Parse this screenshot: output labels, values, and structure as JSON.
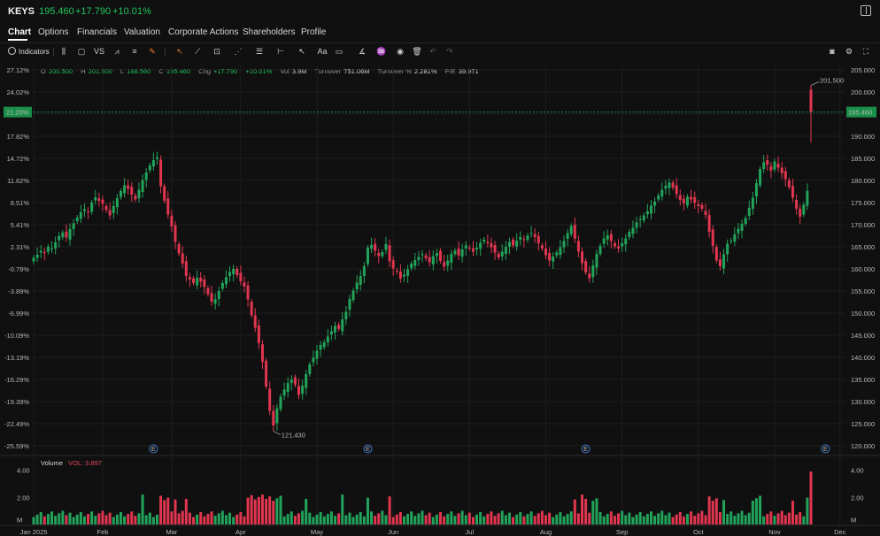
{
  "header": {
    "ticker": "KEYS",
    "price": "195.460",
    "change": "+17.790",
    "change_pct": "+10.01%"
  },
  "tabs": [
    {
      "label": "Chart",
      "active": true
    },
    {
      "label": "Options",
      "active": false
    },
    {
      "label": "Financials",
      "active": false
    },
    {
      "label": "Valuation",
      "active": false
    },
    {
      "label": "Corporate Actions",
      "active": false
    },
    {
      "label": "Shareholders",
      "active": false
    },
    {
      "label": "Profile",
      "active": false
    }
  ],
  "toolbar": {
    "indicators_label": "Indicators",
    "vs_label": "VS",
    "font_label": "Aa"
  },
  "ohlc": {
    "o_label": "O",
    "o": "200.500",
    "h_label": "H",
    "h": "201.500",
    "l_label": "L",
    "l": "188.560",
    "c_label": "C",
    "c": "195.460",
    "chg_label": "Chg",
    "chg": "+17.790",
    "chg_pct": "+10.01%",
    "vol_label": "Vol",
    "vol": "3.9M",
    "turnover_label": "Turnover",
    "turnover": "751.06M",
    "turnover_pct_label": "Turnover %",
    "turnover_pct": "2.281%",
    "pe_label": "P/E",
    "pe": "39.971"
  },
  "volume_panel": {
    "label": "Volume",
    "value_label": "VOL: 3.897"
  },
  "colors": {
    "up": "#22a35a",
    "down": "#e0364f",
    "background": "#101010",
    "grid": "#1e1e1e",
    "current_price_tag": "#1a8f4a",
    "earnings_marker": "#3d7bd9"
  },
  "chart_data": {
    "type": "candlestick",
    "x_labels": [
      "Jan 2025",
      "Feb",
      "Mar",
      "Apr",
      "May",
      "Jun",
      "Jul",
      "Aug",
      "Sep",
      "Oct",
      "Nov",
      "Dec"
    ],
    "y_right_ticks": [
      "205.000",
      "200.000",
      "195.000",
      "190.000",
      "185.000",
      "180.000",
      "175.000",
      "170.000",
      "165.000",
      "160.000",
      "155.000",
      "150.000",
      "145.000",
      "140.000",
      "135.000",
      "130.000",
      "125.000",
      "120.000"
    ],
    "y_left_ticks": [
      "27.12%",
      "24.02%",
      "21.20%",
      "17.82%",
      "14.72%",
      "11.62%",
      "8.51%",
      "5.41%",
      "2.31%",
      "-0.79%",
      "-3.89%",
      "-6.99%",
      "-10.09%",
      "-13.19%",
      "-16.29%",
      "-19.39%",
      "-22.49%",
      "-25.59%"
    ],
    "ylim": [
      118,
      206
    ],
    "current_price": "195.460",
    "current_pct": "21.20%",
    "max_annotation": "201.500",
    "min_annotation": "121.430",
    "earnings_marker_label": "E",
    "earnings_indices": [
      33,
      92,
      152,
      218
    ],
    "volume_ticks": [
      "4.00",
      "2.00",
      "M"
    ],
    "volume_ylim": [
      0,
      4.1
    ],
    "closes": [
      162.5,
      163.2,
      164.1,
      163.6,
      165.0,
      164.6,
      166.0,
      167.4,
      168.2,
      167.1,
      169.0,
      170.3,
      171.6,
      172.8,
      173.5,
      172.9,
      175.0,
      176.2,
      175.4,
      174.7,
      173.3,
      172.1,
      174.2,
      176.0,
      177.6,
      178.9,
      178.1,
      176.8,
      175.7,
      177.9,
      180.1,
      181.8,
      183.4,
      184.6,
      185.2,
      178.7,
      175.4,
      172.3,
      169.6,
      166.1,
      163.5,
      161.2,
      158.4,
      157.6,
      156.8,
      158.0,
      157.1,
      155.9,
      154.3,
      152.6,
      153.2,
      155.0,
      156.8,
      158.1,
      159.3,
      160.0,
      158.6,
      157.2,
      156.0,
      153.1,
      149.5,
      146.7,
      143.2,
      139.0,
      133.4,
      127.9,
      124.6,
      128.5,
      131.1,
      132.7,
      134.2,
      135.0,
      133.8,
      131.5,
      133.6,
      136.2,
      138.4,
      139.9,
      141.5,
      142.8,
      143.4,
      144.7,
      145.9,
      147.1,
      146.4,
      148.6,
      150.3,
      153.2,
      155.1,
      156.9,
      158.4,
      160.6,
      164.8,
      165.4,
      164.1,
      162.9,
      163.8,
      165.6,
      161.7,
      160.1,
      159.4,
      157.8,
      158.7,
      159.9,
      161.2,
      162.0,
      162.7,
      163.3,
      162.4,
      161.5,
      162.9,
      163.6,
      161.8,
      160.5,
      161.9,
      163.4,
      164.1,
      163.0,
      164.4,
      165.3,
      164.7,
      163.9,
      164.8,
      165.9,
      166.6,
      165.8,
      164.9,
      163.7,
      162.6,
      163.9,
      165.0,
      166.1,
      165.3,
      166.4,
      167.2,
      166.5,
      167.5,
      168.1,
      167.2,
      165.8,
      164.6,
      163.1,
      161.9,
      162.8,
      163.7,
      164.9,
      166.3,
      168.1,
      169.7,
      166.8,
      163.9,
      161.3,
      159.2,
      157.9,
      160.8,
      163.4,
      165.2,
      166.9,
      167.6,
      166.3,
      165.1,
      164.6,
      165.8,
      166.9,
      168.4,
      169.3,
      170.5,
      171.2,
      172.1,
      173.0,
      174.3,
      175.2,
      176.6,
      177.9,
      178.8,
      179.5,
      178.4,
      176.9,
      175.6,
      174.8,
      176.3,
      175.7,
      174.9,
      174.2,
      173.6,
      172.2,
      168.4,
      165.2,
      161.9,
      160.6,
      163.3,
      165.7,
      166.4,
      167.8,
      169.1,
      170.2,
      171.5,
      173.8,
      176.1,
      179.4,
      182.6,
      184.1,
      183.5,
      182.2,
      184.3,
      182.9,
      181.6,
      180.3,
      178.5,
      176.1,
      173.6,
      171.8,
      174.5,
      177.67,
      195.46
    ]
  }
}
